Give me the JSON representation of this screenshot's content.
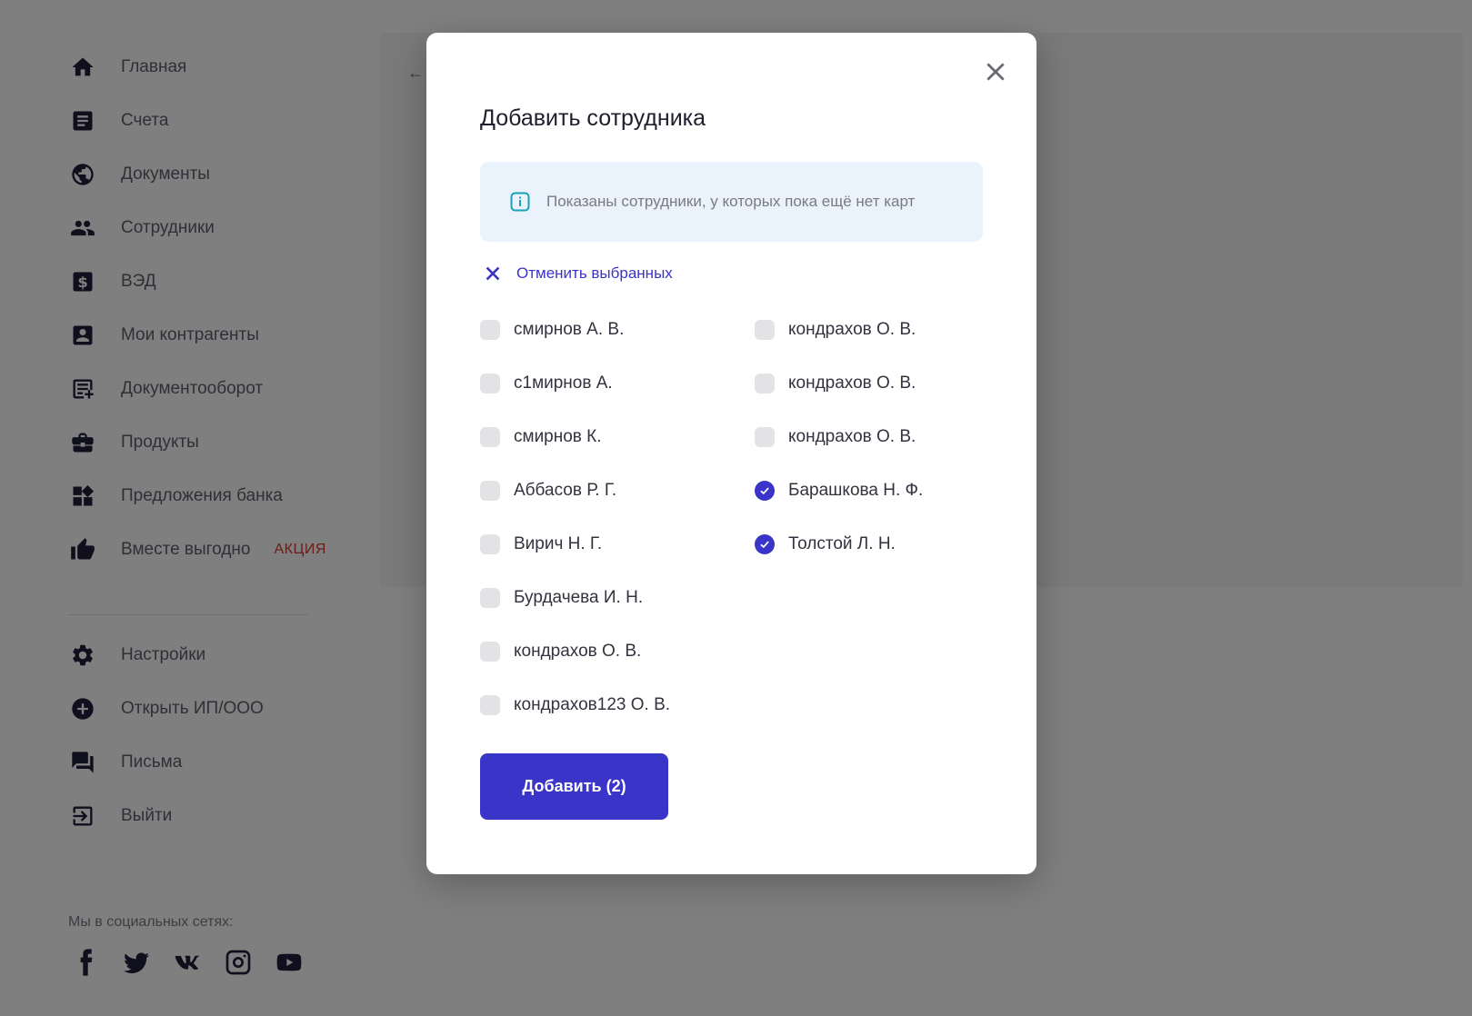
{
  "sidebar": {
    "items": [
      {
        "label": "Главная",
        "icon": "home-icon"
      },
      {
        "label": "Счета",
        "icon": "document-icon"
      },
      {
        "label": "Документы",
        "icon": "globe-icon"
      },
      {
        "label": "Сотрудники",
        "icon": "people-icon"
      },
      {
        "label": "ВЭД",
        "icon": "dollar-icon"
      },
      {
        "label": "Мои контрагенты",
        "icon": "contact-icon"
      },
      {
        "label": "Документооборот",
        "icon": "document-add-icon"
      },
      {
        "label": "Продукты",
        "icon": "briefcase-icon"
      },
      {
        "label": "Предложения банка",
        "icon": "widgets-icon"
      },
      {
        "label": "Вместе выгодно",
        "icon": "thumbs-up-icon",
        "badge": "АКЦИЯ"
      }
    ],
    "bottom_items": [
      {
        "label": "Настройки",
        "icon": "gear-icon"
      },
      {
        "label": "Открыть ИП/ООО",
        "icon": "plus-circle-icon"
      },
      {
        "label": "Письма",
        "icon": "chat-icon"
      },
      {
        "label": "Выйти",
        "icon": "logout-icon"
      }
    ],
    "social_title": "Мы в социальных сетях:",
    "social": [
      "facebook-icon",
      "twitter-icon",
      "vk-icon",
      "instagram-icon",
      "youtube-icon"
    ]
  },
  "main": {
    "back_arrow": "←"
  },
  "modal": {
    "title": "Добавить сотрудника",
    "info_text": "Показаны сотрудники, у которых пока ещё нет карт",
    "cancel_selected_label": "Отменить выбранных",
    "employees_left": [
      {
        "name": "смирнов А. В.",
        "checked": false
      },
      {
        "name": "с1мирнов А.",
        "checked": false
      },
      {
        "name": "смирнов К.",
        "checked": false
      },
      {
        "name": "Аббасов Р. Г.",
        "checked": false
      },
      {
        "name": "Вирич Н. Г.",
        "checked": false
      },
      {
        "name": "Бурдачева И. Н.",
        "checked": false
      },
      {
        "name": "кондрахов О. В.",
        "checked": false
      },
      {
        "name": "кондрахов123 О. В.",
        "checked": false
      }
    ],
    "employees_right": [
      {
        "name": "кондрахов О. В.",
        "checked": false
      },
      {
        "name": "кондрахов О. В.",
        "checked": false
      },
      {
        "name": "кондрахов О. В.",
        "checked": false
      },
      {
        "name": "Барашкова Н. Ф.",
        "checked": true
      },
      {
        "name": "Толстой Л. Н.",
        "checked": true
      }
    ],
    "add_button_label": "Добавить (2)"
  },
  "colors": {
    "accent": "#3a34c8",
    "info_bg": "#eaf3fc",
    "promo": "#d43b2c",
    "overlay": "rgba(0,0,0,0.5)"
  }
}
